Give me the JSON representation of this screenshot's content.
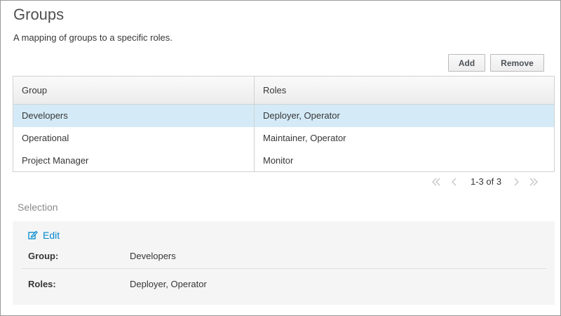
{
  "page": {
    "title": "Groups",
    "description": "A mapping of groups to a specific roles."
  },
  "toolbar": {
    "add_label": "Add",
    "remove_label": "Remove"
  },
  "table": {
    "columns": [
      "Group",
      "Roles"
    ],
    "rows": [
      {
        "group": "Developers",
        "roles": "Deployer, Operator",
        "selected": true
      },
      {
        "group": "Operational",
        "roles": "Maintainer, Operator",
        "selected": false
      },
      {
        "group": "Project Manager",
        "roles": "Monitor",
        "selected": false
      }
    ]
  },
  "pagination": {
    "info": "1-3 of 3",
    "first_icon": "double-chevron-left-icon",
    "prev_icon": "chevron-left-icon",
    "next_icon": "chevron-right-icon",
    "last_icon": "double-chevron-right-icon"
  },
  "selection": {
    "label": "Selection",
    "edit_label": "Edit",
    "edit_icon": "edit-icon",
    "fields": [
      {
        "label": "Group:",
        "value": "Developers"
      },
      {
        "label": "Roles:",
        "value": "Deployer, Operator"
      }
    ]
  },
  "colors": {
    "selected_row": "#d4ebf7",
    "link": "#0088ce",
    "panel_bg": "#f5f5f5"
  }
}
